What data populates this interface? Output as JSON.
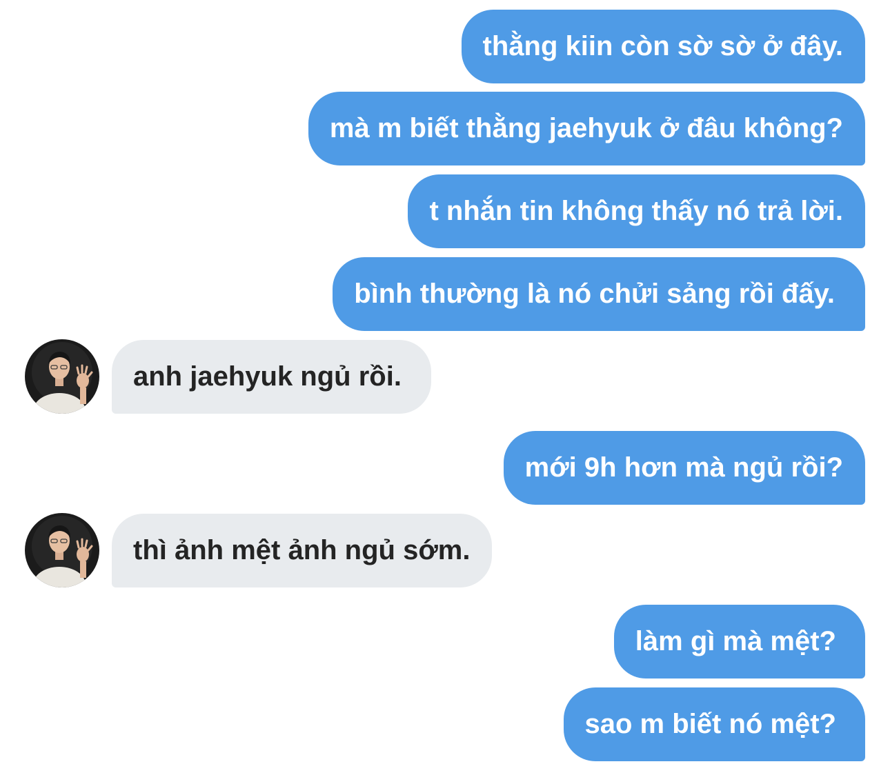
{
  "conversation": {
    "messages": [
      {
        "text": "thằng kiin còn sờ sờ ở đây."
      },
      {
        "text": "mà m biết thằng jaehyuk ở đâu không?"
      },
      {
        "text": "t nhắn tin không thấy nó trả lời."
      },
      {
        "text": "bình thường là nó chửi sảng rồi đấy."
      },
      {
        "text": "anh jaehyuk ngủ rồi."
      },
      {
        "text": "mới 9h hơn mà ngủ rồi?"
      },
      {
        "text": "thì ảnh mệt ảnh ngủ sớm."
      },
      {
        "text": "làm gì mà mệt?"
      },
      {
        "text": "sao m biết nó mệt?"
      }
    ]
  },
  "colors": {
    "sent_bubble": "#4f9be6",
    "sent_text": "#ffffff",
    "received_bubble": "#e8ebee",
    "received_text": "#242424",
    "background": "#ffffff"
  }
}
